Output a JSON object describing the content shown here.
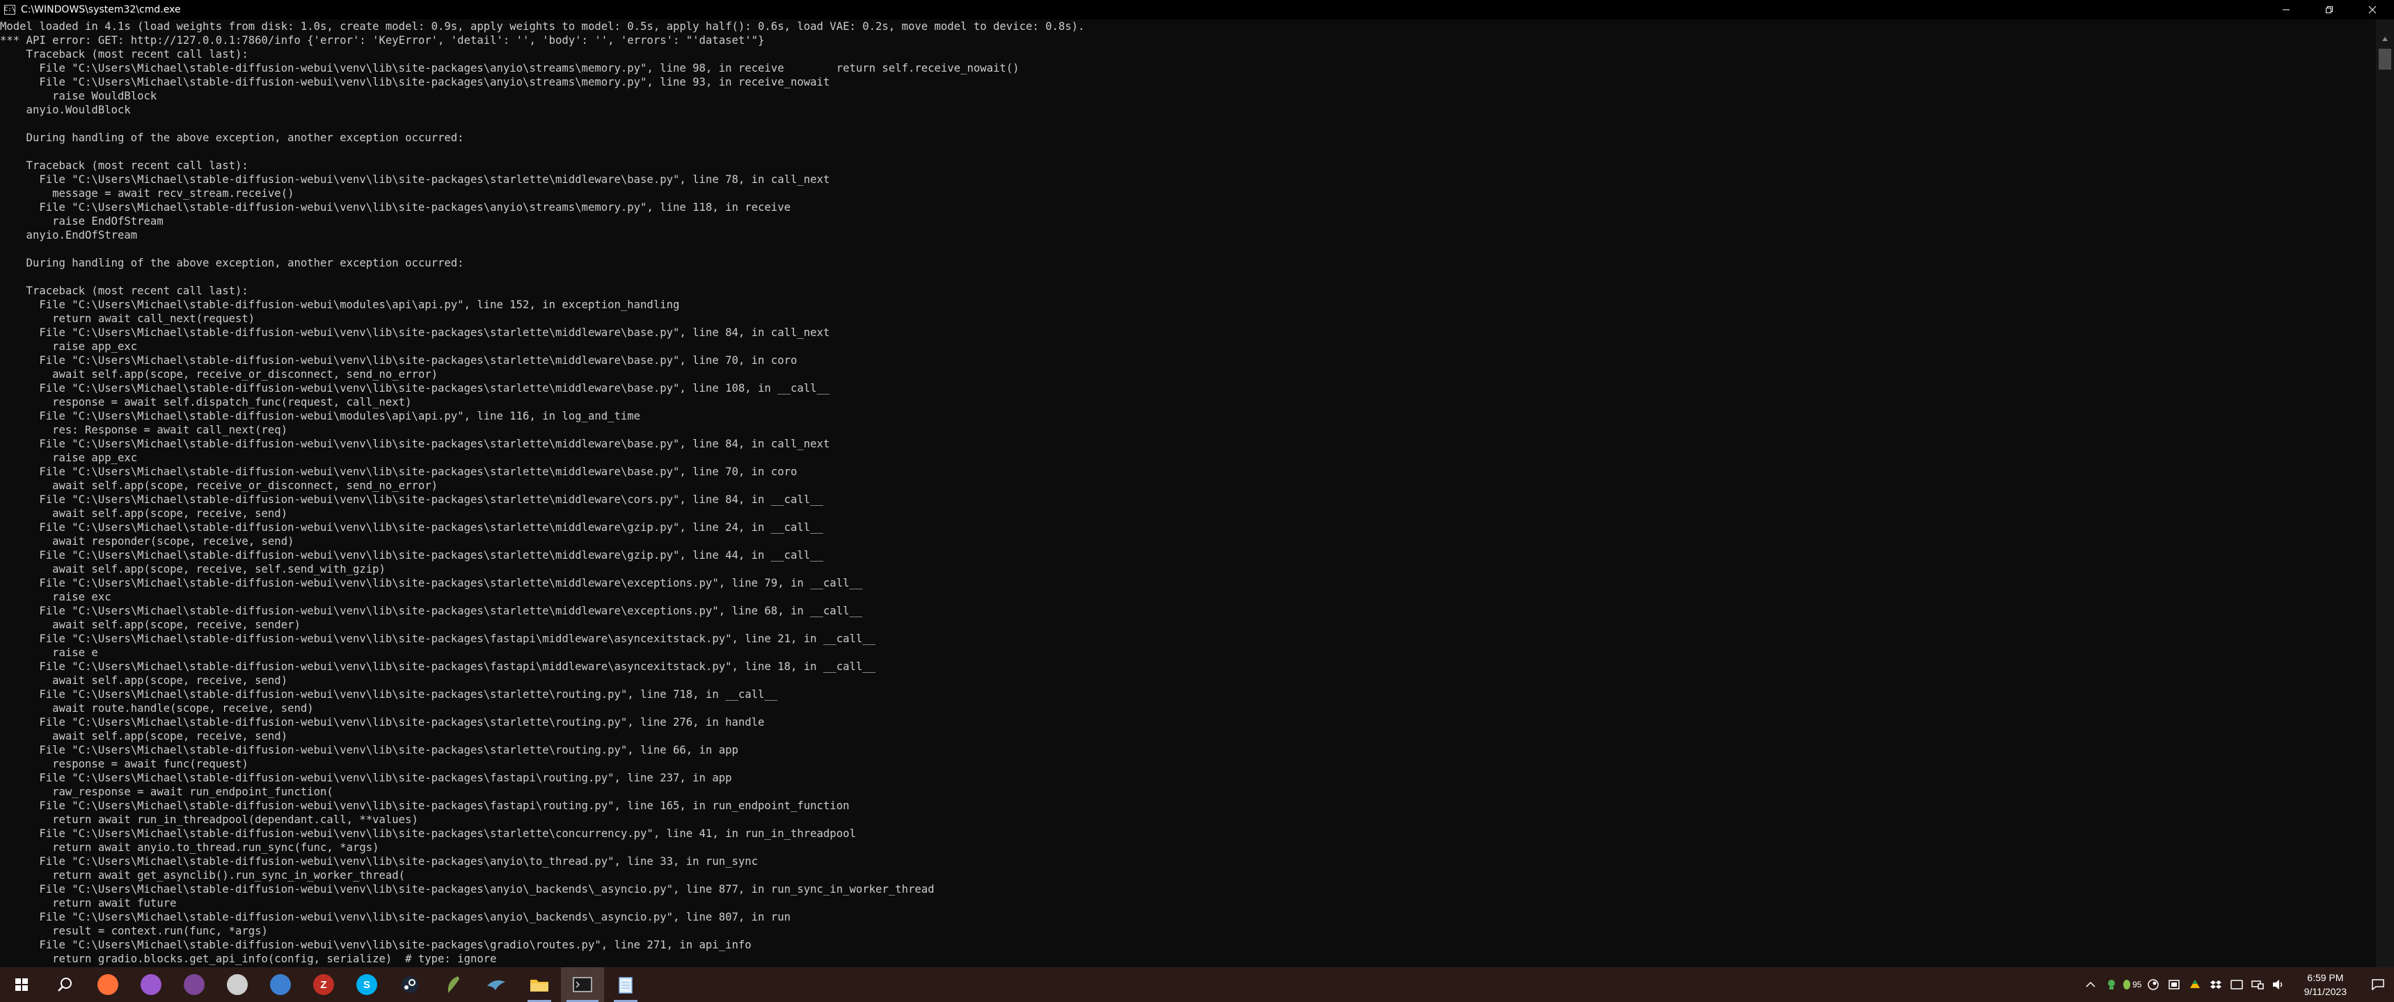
{
  "window": {
    "title": "C:\\WINDOWS\\system32\\cmd.exe",
    "app_icon_text": "C:\\"
  },
  "console": {
    "lines": [
      "Model loaded in 4.1s (load weights from disk: 1.0s, create model: 0.9s, apply weights to model: 0.5s, apply half(): 0.6s, load VAE: 0.2s, move model to device: 0.8s).",
      "*** API error: GET: http://127.0.0.1:7860/info {'error': 'KeyError', 'detail': '', 'body': '', 'errors': \"'dataset'\"}",
      "    Traceback (most recent call last):",
      "      File \"C:\\Users\\Michael\\stable-diffusion-webui\\venv\\lib\\site-packages\\anyio\\streams\\memory.py\", line 98, in receive        return self.receive_nowait()",
      "      File \"C:\\Users\\Michael\\stable-diffusion-webui\\venv\\lib\\site-packages\\anyio\\streams\\memory.py\", line 93, in receive_nowait",
      "        raise WouldBlock",
      "    anyio.WouldBlock",
      "",
      "    During handling of the above exception, another exception occurred:",
      "",
      "    Traceback (most recent call last):",
      "      File \"C:\\Users\\Michael\\stable-diffusion-webui\\venv\\lib\\site-packages\\starlette\\middleware\\base.py\", line 78, in call_next",
      "        message = await recv_stream.receive()",
      "      File \"C:\\Users\\Michael\\stable-diffusion-webui\\venv\\lib\\site-packages\\anyio\\streams\\memory.py\", line 118, in receive",
      "        raise EndOfStream",
      "    anyio.EndOfStream",
      "",
      "    During handling of the above exception, another exception occurred:",
      "",
      "    Traceback (most recent call last):",
      "      File \"C:\\Users\\Michael\\stable-diffusion-webui\\modules\\api\\api.py\", line 152, in exception_handling",
      "        return await call_next(request)",
      "      File \"C:\\Users\\Michael\\stable-diffusion-webui\\venv\\lib\\site-packages\\starlette\\middleware\\base.py\", line 84, in call_next",
      "        raise app_exc",
      "      File \"C:\\Users\\Michael\\stable-diffusion-webui\\venv\\lib\\site-packages\\starlette\\middleware\\base.py\", line 70, in coro",
      "        await self.app(scope, receive_or_disconnect, send_no_error)",
      "      File \"C:\\Users\\Michael\\stable-diffusion-webui\\venv\\lib\\site-packages\\starlette\\middleware\\base.py\", line 108, in __call__",
      "        response = await self.dispatch_func(request, call_next)",
      "      File \"C:\\Users\\Michael\\stable-diffusion-webui\\modules\\api\\api.py\", line 116, in log_and_time",
      "        res: Response = await call_next(req)",
      "      File \"C:\\Users\\Michael\\stable-diffusion-webui\\venv\\lib\\site-packages\\starlette\\middleware\\base.py\", line 84, in call_next",
      "        raise app_exc",
      "      File \"C:\\Users\\Michael\\stable-diffusion-webui\\venv\\lib\\site-packages\\starlette\\middleware\\base.py\", line 70, in coro",
      "        await self.app(scope, receive_or_disconnect, send_no_error)",
      "      File \"C:\\Users\\Michael\\stable-diffusion-webui\\venv\\lib\\site-packages\\starlette\\middleware\\cors.py\", line 84, in __call__",
      "        await self.app(scope, receive, send)",
      "      File \"C:\\Users\\Michael\\stable-diffusion-webui\\venv\\lib\\site-packages\\starlette\\middleware\\gzip.py\", line 24, in __call__",
      "        await responder(scope, receive, send)",
      "      File \"C:\\Users\\Michael\\stable-diffusion-webui\\venv\\lib\\site-packages\\starlette\\middleware\\gzip.py\", line 44, in __call__",
      "        await self.app(scope, receive, self.send_with_gzip)",
      "      File \"C:\\Users\\Michael\\stable-diffusion-webui\\venv\\lib\\site-packages\\starlette\\middleware\\exceptions.py\", line 79, in __call__",
      "        raise exc",
      "      File \"C:\\Users\\Michael\\stable-diffusion-webui\\venv\\lib\\site-packages\\starlette\\middleware\\exceptions.py\", line 68, in __call__",
      "        await self.app(scope, receive, sender)",
      "      File \"C:\\Users\\Michael\\stable-diffusion-webui\\venv\\lib\\site-packages\\fastapi\\middleware\\asyncexitstack.py\", line 21, in __call__",
      "        raise e",
      "      File \"C:\\Users\\Michael\\stable-diffusion-webui\\venv\\lib\\site-packages\\fastapi\\middleware\\asyncexitstack.py\", line 18, in __call__",
      "        await self.app(scope, receive, send)",
      "      File \"C:\\Users\\Michael\\stable-diffusion-webui\\venv\\lib\\site-packages\\starlette\\routing.py\", line 718, in __call__",
      "        await route.handle(scope, receive, send)",
      "      File \"C:\\Users\\Michael\\stable-diffusion-webui\\venv\\lib\\site-packages\\starlette\\routing.py\", line 276, in handle",
      "        await self.app(scope, receive, send)",
      "      File \"C:\\Users\\Michael\\stable-diffusion-webui\\venv\\lib\\site-packages\\starlette\\routing.py\", line 66, in app",
      "        response = await func(request)",
      "      File \"C:\\Users\\Michael\\stable-diffusion-webui\\venv\\lib\\site-packages\\fastapi\\routing.py\", line 237, in app",
      "        raw_response = await run_endpoint_function(",
      "      File \"C:\\Users\\Michael\\stable-diffusion-webui\\venv\\lib\\site-packages\\fastapi\\routing.py\", line 165, in run_endpoint_function",
      "        return await run_in_threadpool(dependant.call, **values)",
      "      File \"C:\\Users\\Michael\\stable-diffusion-webui\\venv\\lib\\site-packages\\starlette\\concurrency.py\", line 41, in run_in_threadpool",
      "        return await anyio.to_thread.run_sync(func, *args)",
      "      File \"C:\\Users\\Michael\\stable-diffusion-webui\\venv\\lib\\site-packages\\anyio\\to_thread.py\", line 33, in run_sync",
      "        return await get_asynclib().run_sync_in_worker_thread(",
      "      File \"C:\\Users\\Michael\\stable-diffusion-webui\\venv\\lib\\site-packages\\anyio\\_backends\\_asyncio.py\", line 877, in run_sync_in_worker_thread",
      "        return await future",
      "      File \"C:\\Users\\Michael\\stable-diffusion-webui\\venv\\lib\\site-packages\\anyio\\_backends\\_asyncio.py\", line 807, in run",
      "        result = context.run(func, *args)",
      "      File \"C:\\Users\\Michael\\stable-diffusion-webui\\venv\\lib\\site-packages\\gradio\\routes.py\", line 271, in api_info",
      "        return gradio.blocks.get_api_info(config, serialize)  # type: ignore"
    ]
  },
  "taskbar": {
    "apps": [
      {
        "name": "start",
        "icon": "windows-logo-icon",
        "glyph": "",
        "color": "#ffffff"
      },
      {
        "name": "search",
        "icon": "search-icon",
        "glyph": "",
        "color": "#ffffff"
      },
      {
        "name": "firefox",
        "icon": "firefox-icon",
        "glyph": "",
        "color": "#ff7139"
      },
      {
        "name": "app-purple-cat",
        "icon": "cat-app-icon",
        "glyph": "",
        "color": "#9b59d0"
      },
      {
        "name": "tor",
        "icon": "tor-browser-icon",
        "glyph": "",
        "color": "#7d4698"
      },
      {
        "name": "unity",
        "icon": "unity-icon",
        "glyph": "",
        "color": "#cfcfcf"
      },
      {
        "name": "app-blue-orb",
        "icon": "blue-orb-icon",
        "glyph": "",
        "color": "#3d7fd1"
      },
      {
        "name": "filezilla",
        "icon": "filezilla-icon",
        "glyph": "Z",
        "color": "#bf2f24"
      },
      {
        "name": "skype",
        "icon": "skype-icon",
        "glyph": "S",
        "color": "#00aff0"
      },
      {
        "name": "steam",
        "icon": "steam-icon",
        "glyph": "",
        "color": "#1b2838"
      },
      {
        "name": "inkscape-like",
        "icon": "feather-app-icon",
        "glyph": "",
        "color": "#7fa34a"
      },
      {
        "name": "app-bird",
        "icon": "bird-app-icon",
        "glyph": "",
        "color": "#5a9bc9"
      },
      {
        "name": "file-explorer",
        "icon": "folder-icon",
        "glyph": "",
        "color": "#f3c13a"
      },
      {
        "name": "command-prompt",
        "icon": "terminal-icon",
        "glyph": "",
        "color": "#cccccc"
      },
      {
        "name": "notepad-like",
        "icon": "notepad-icon",
        "glyph": "",
        "color": "#7fb2e5"
      }
    ],
    "tray": {
      "temperature_badge": "95",
      "time": "6:59 PM",
      "date": "9/11/2023"
    }
  },
  "colors": {
    "console_bg": "#0c0c0c",
    "console_text": "#cccccc",
    "titlebar_bg": "#000000",
    "taskbar_bg": "#2b1a16",
    "accent": "#8fa8d8"
  }
}
